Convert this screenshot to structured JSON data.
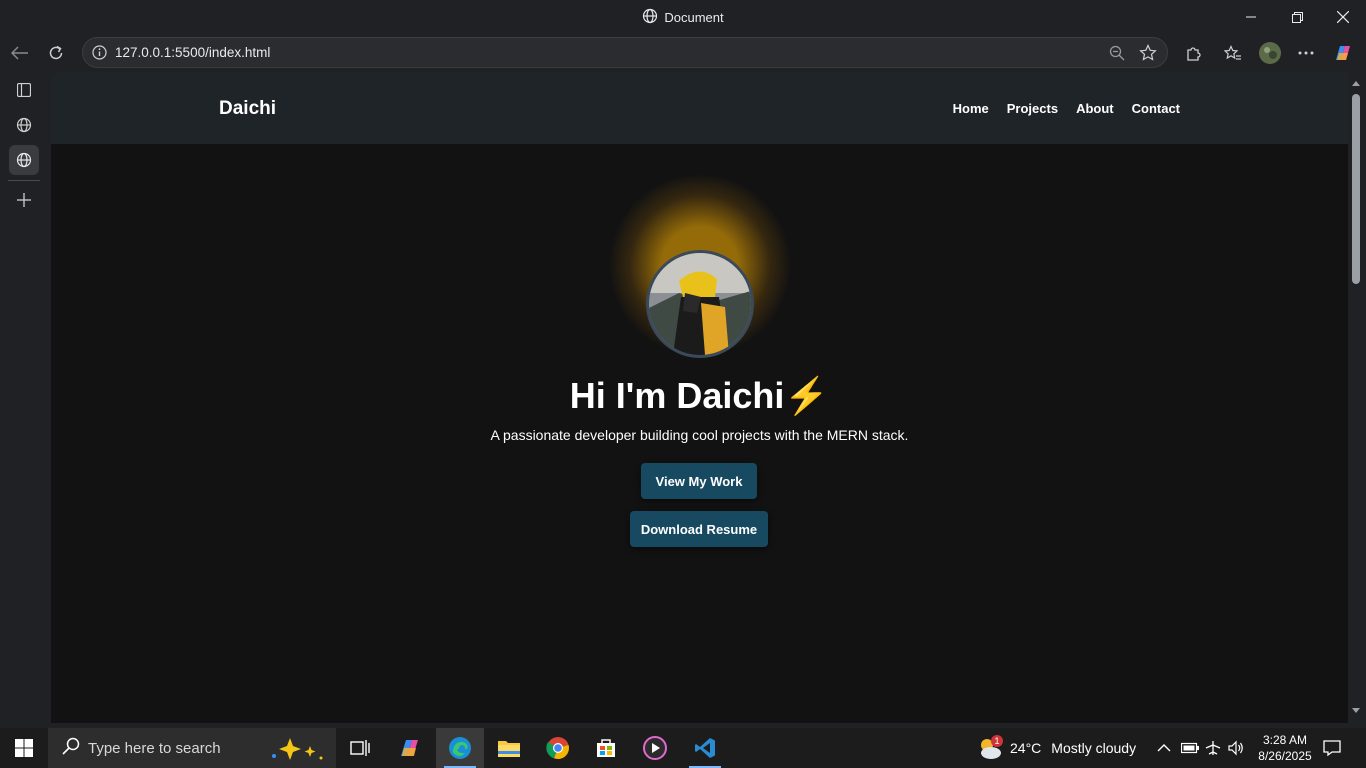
{
  "window": {
    "title": "Document"
  },
  "browser": {
    "url": "127.0.0.1:5500/index.html"
  },
  "site": {
    "brand": "Daichi",
    "nav": [
      {
        "label": "Home"
      },
      {
        "label": "Projects"
      },
      {
        "label": "About"
      },
      {
        "label": "Contact"
      }
    ],
    "hero": {
      "title": "Hi I'm Daichi⚡",
      "subtitle": "A passionate developer building cool projects with the MERN stack.",
      "primary_button": "View My Work",
      "secondary_button": "Download Resume"
    }
  },
  "taskbar": {
    "search_placeholder": "Type here to search",
    "weather": {
      "temp": "24°C",
      "condition": "Mostly cloudy",
      "badge": "1"
    },
    "time": "3:28 AM",
    "date": "8/26/2025"
  },
  "colors": {
    "page_bg": "#121212",
    "nav_bg": "#1f2428",
    "button_bg": "#174a61",
    "accent_glow": "#ffb400"
  }
}
